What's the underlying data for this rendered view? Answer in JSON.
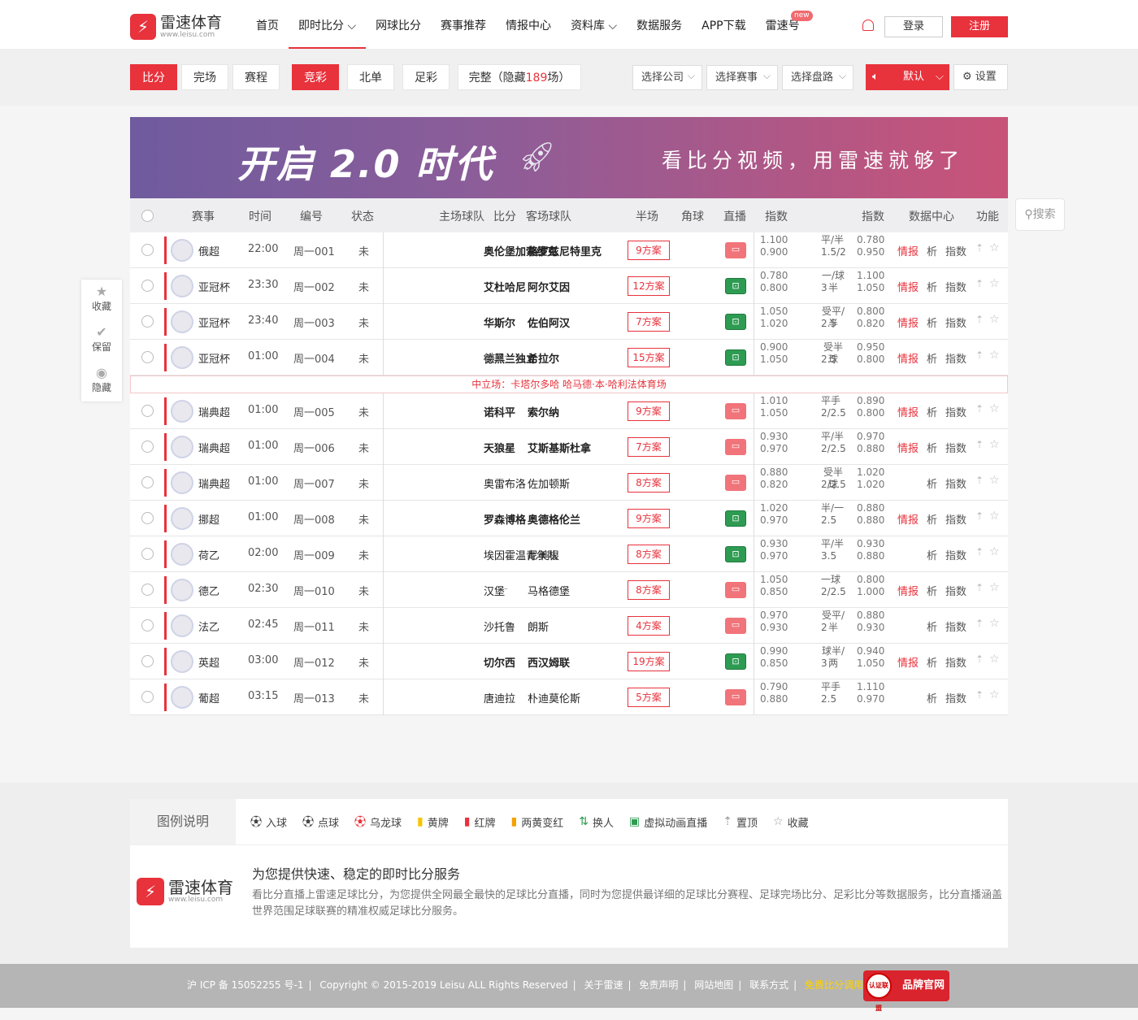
{
  "header": {
    "logo_name": "雷速体育",
    "logo_url": "www.leisu.com",
    "nav": [
      {
        "label": "首页"
      },
      {
        "label": "即时比分 ⌵"
      },
      {
        "label": "网球比分"
      },
      {
        "label": "赛事推荐"
      },
      {
        "label": "情报中心"
      },
      {
        "label": "资料库 ⌵"
      },
      {
        "label": "数据服务"
      },
      {
        "label": "APP下载"
      },
      {
        "label": "雷速号",
        "badge": "new"
      }
    ],
    "login": "登录",
    "register": "注册"
  },
  "toolbar": {
    "tabs": [
      "比分",
      "完场",
      "赛程",
      "竞彩",
      "北单",
      "足彩"
    ],
    "full_prefix": "完整（隐藏",
    "hidden_count": "189",
    "full_suffix": "场）",
    "select_company": "选择公司",
    "select_match": "选择赛事",
    "select_line": "选择盘路",
    "default": "默认",
    "settings": "设置"
  },
  "banner": {
    "big": "开启 2.0 时代",
    "slogan": "看比分视频，用雷速就够了"
  },
  "table": {
    "headers": {
      "league": "赛事",
      "time": "时间",
      "number": "编号",
      "status": "状态",
      "home": "主场球队",
      "score": "比分",
      "away": "客场球队",
      "half": "半场",
      "corner": "角球",
      "live": "直播",
      "odds1": "指数",
      "odds2": "指数",
      "data": "数据中心",
      "func": "功能"
    },
    "rows": [
      {
        "league": "俄超",
        "time": "22:00",
        "no": "周一001",
        "status": "未",
        "home": "奥伦堡加索维克",
        "away": "格罗兹尼特里克",
        "plan": "9方案",
        "live": "video",
        "o1a": "1.100",
        "o1b": "0.900",
        "hc1": "平/半",
        "hc2": "1.5/2",
        "o2a": "0.780",
        "o2b": "0.950",
        "intel": "情报",
        "ana": "析",
        "idx": "指数",
        "bold": true
      },
      {
        "league": "亚冠杯",
        "time": "23:30",
        "no": "周一002",
        "status": "未",
        "home": "艾杜哈尼",
        "away": "阿尔艾因",
        "plan": "12方案",
        "live": "anim",
        "o1a": "0.780",
        "o1b": "0.800",
        "hc1": "一/球半",
        "hc2": "3",
        "o2a": "1.100",
        "o2b": "1.050",
        "intel": "情报",
        "ana": "析",
        "idx": "指数",
        "bold": true
      },
      {
        "league": "亚冠杯",
        "time": "23:40",
        "no": "周一003",
        "status": "未",
        "home": "华斯尔",
        "away": "佐伯阿汉",
        "plan": "7方案",
        "live": "anim",
        "o1a": "1.050",
        "o1b": "1.020",
        "hc1": "受平/半",
        "hc2": "2.5",
        "o2a": "0.800",
        "o2b": "0.820",
        "intel": "情报",
        "ana": "析",
        "idx": "指数",
        "bold": true
      },
      {
        "league": "亚冠杯",
        "time": "01:00",
        "no": "周一004",
        "status": "未",
        "home": "德黑兰独立",
        "neutral": "(中)",
        "away": "希拉尔",
        "plan": "15方案",
        "live": "anim",
        "o1a": "0.900",
        "o1b": "1.050",
        "hc1": "受半球",
        "hc2": "2.5",
        "o2a": "0.950",
        "o2b": "0.800",
        "intel": "情报",
        "ana": "析",
        "idx": "指数",
        "bold": true,
        "venue": "中立场：卡塔尔多哈 哈马德·本·哈利法体育场"
      },
      {
        "league": "瑞典超",
        "time": "01:00",
        "no": "周一005",
        "status": "未",
        "home": "诺科平",
        "away": "索尔纳",
        "plan": "9方案",
        "live": "video",
        "o1a": "1.010",
        "o1b": "1.050",
        "hc1": "平手",
        "hc2": "2/2.5",
        "o2a": "0.890",
        "o2b": "0.800",
        "intel": "情报",
        "ana": "析",
        "idx": "指数",
        "bold": true
      },
      {
        "league": "瑞典超",
        "time": "01:00",
        "no": "周一006",
        "status": "未",
        "home": "天狼星",
        "away": "艾斯基斯杜拿",
        "plan": "7方案",
        "live": "video",
        "o1a": "0.930",
        "o1b": "0.970",
        "hc1": "平/半",
        "hc2": "2/2.5",
        "o2a": "0.970",
        "o2b": "0.880",
        "intel": "情报",
        "ana": "析",
        "idx": "指数",
        "bold": true
      },
      {
        "league": "瑞典超",
        "time": "01:00",
        "no": "周一007",
        "status": "未",
        "home": "奥雷布洛",
        "away": "佐加顿斯",
        "plan": "8方案",
        "live": "video",
        "o1a": "0.880",
        "o1b": "0.820",
        "hc1": "受半球",
        "hc2": "2/2.5",
        "o2a": "1.020",
        "o2b": "1.020",
        "intel": "",
        "ana": "析",
        "idx": "指数",
        "bold": false
      },
      {
        "league": "挪超",
        "time": "01:00",
        "no": "周一008",
        "status": "未",
        "home": "罗森博格",
        "away": "奥德格伦兰",
        "plan": "9方案",
        "live": "anim",
        "o1a": "1.020",
        "o1b": "0.970",
        "hc1": "半/一",
        "hc2": "2.5",
        "o2a": "0.880",
        "o2b": "0.880",
        "intel": "情报",
        "ana": "析",
        "idx": "指数",
        "bold": true
      },
      {
        "league": "荷乙",
        "time": "02:00",
        "no": "周一009",
        "status": "未",
        "home": "埃因霍温青年队",
        "away": "尼美根",
        "plan": "8方案",
        "live": "anim",
        "o1a": "0.930",
        "o1b": "0.970",
        "hc1": "平/半",
        "hc2": "3.5",
        "o2a": "0.930",
        "o2b": "0.880",
        "intel": "",
        "ana": "析",
        "idx": "指数",
        "bold": false
      },
      {
        "league": "德乙",
        "time": "02:30",
        "no": "周一010",
        "status": "未",
        "home": "汉堡",
        "away": "马格德堡",
        "plan": "8方案",
        "live": "video",
        "o1a": "1.050",
        "o1b": "0.850",
        "hc1": "一球",
        "hc2": "2/2.5",
        "o2a": "0.800",
        "o2b": "1.000",
        "intel": "情报",
        "ana": "析",
        "idx": "指数",
        "bold": false
      },
      {
        "league": "法乙",
        "time": "02:45",
        "no": "周一011",
        "status": "未",
        "home": "沙托鲁",
        "away": "朗斯",
        "plan": "4方案",
        "live": "video",
        "o1a": "0.970",
        "o1b": "0.930",
        "hc1": "受平/半",
        "hc2": "2",
        "o2a": "0.880",
        "o2b": "0.930",
        "intel": "",
        "ana": "析",
        "idx": "指数",
        "bold": false
      },
      {
        "league": "英超",
        "time": "03:00",
        "no": "周一012",
        "status": "未",
        "home": "切尔西",
        "away": "西汉姆联",
        "plan": "19方案",
        "live": "anim",
        "o1a": "0.990",
        "o1b": "0.850",
        "hc1": "球半/两",
        "hc2": "3",
        "o2a": "0.940",
        "o2b": "1.050",
        "intel": "情报",
        "ana": "析",
        "idx": "指数",
        "bold": true
      },
      {
        "league": "葡超",
        "time": "03:15",
        "no": "周一013",
        "status": "未",
        "home": "唐迪拉",
        "away": "朴迪莫伦斯",
        "plan": "5方案",
        "live": "video",
        "o1a": "0.790",
        "o1b": "0.880",
        "hc1": "平手",
        "hc2": "2.5",
        "o2a": "1.110",
        "o2b": "0.970",
        "intel": "",
        "ana": "析",
        "idx": "指数",
        "bold": false
      }
    ]
  },
  "side": {
    "fav": "收藏",
    "keep": "保留",
    "hide": "隐藏"
  },
  "search": "搜索",
  "legend": {
    "title": "图例说明",
    "items": [
      "入球",
      "点球",
      "乌龙球",
      "黄牌",
      "红牌",
      "两黄变红",
      "换人",
      "虚拟动画直播",
      "置顶",
      "收藏"
    ]
  },
  "about": {
    "title": "为您提供快速、稳定的即时比分服务",
    "text": "看比分直播上雷速足球比分，为您提供全网最全最快的足球比分直播，同时为您提供最详细的足球比分赛程、足球完场比分、足彩比分等数据服务，比分直播涵盖世界范围足球联赛的精准权威足球比分服务。"
  },
  "footer": {
    "icp": "沪 ICP 备 15052255 号-1",
    "copyright": "Copyright © 2015-2019 Leisu ALL Rights Reserved",
    "links": [
      "关于雷速",
      "免责声明",
      "网站地图",
      "联系方式"
    ],
    "highlight": "免费比分调用",
    "badge": "品牌官网",
    "badge_circle": "认证联盟"
  },
  "colors": {
    "accent": "#e8323c",
    "live_video": "#f0747a",
    "live_anim": "#2e9b52"
  }
}
